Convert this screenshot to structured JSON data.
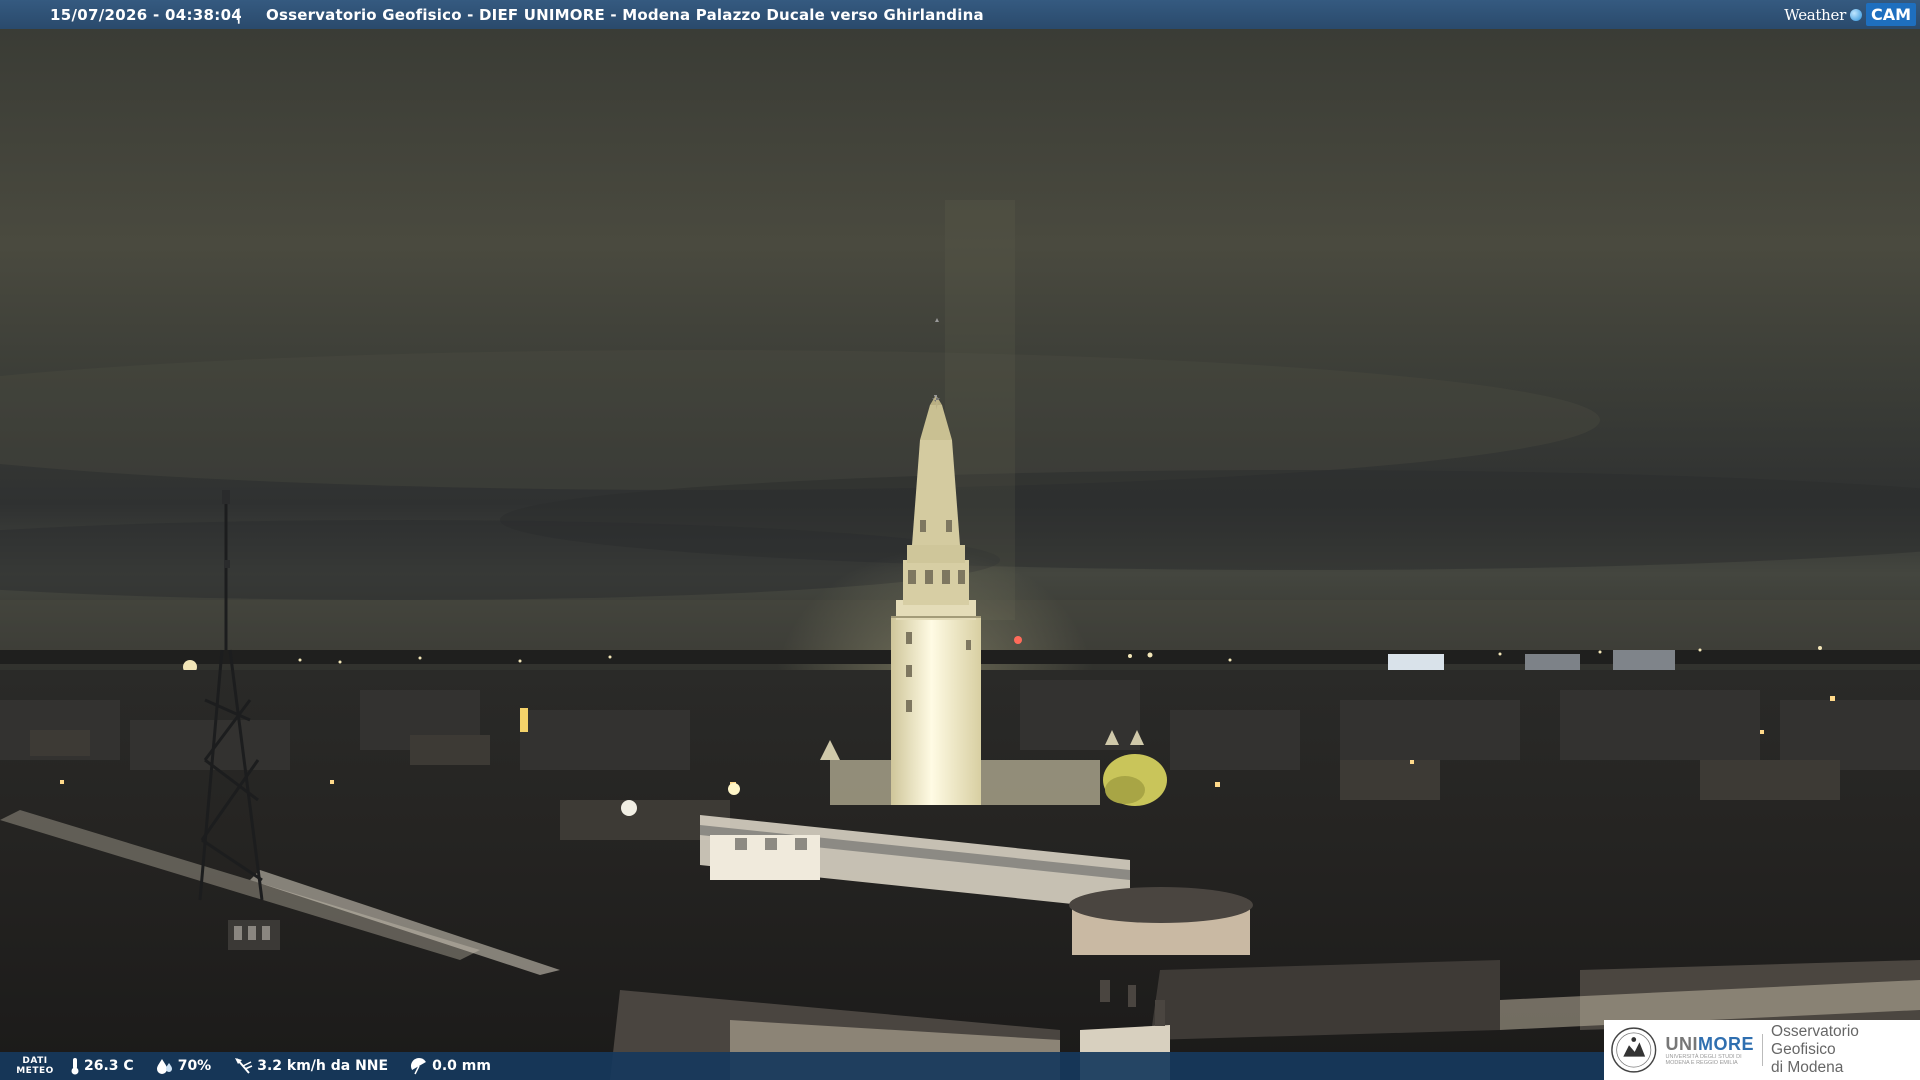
{
  "header": {
    "timestamp": "15/07/2026 - 04:38:04",
    "separator": "|",
    "camera_title": "Osservatorio Geofisico - DIEF UNIMORE - Modena Palazzo Ducale verso Ghirlandina",
    "brand_weather": "Weather",
    "brand_cam": "CAM"
  },
  "weather_bar": {
    "dati_line1": "DATI",
    "dati_line2": "METEO",
    "temperature": "26.3 C",
    "humidity": "70%",
    "wind": "3.2 km/h da NNE",
    "rain": "0.0 mm"
  },
  "logo": {
    "uni_prefix": "UNI",
    "uni_suffix": "MORE",
    "uni_sub_line1": "UNIVERSITÀ DEGLI STUDI DI",
    "uni_sub_line2": "MODENA E REGGIO EMILIA",
    "obs_line1": "Osservatorio Geofisico",
    "obs_line2": "di Modena"
  },
  "colors": {
    "top_bar": "#2a4a6c",
    "bottom_bar": "#16385c",
    "accent_blue": "#2f6fb0",
    "sky": "#3b3b33"
  },
  "icons": {
    "temperature": "thermometer-icon",
    "humidity": "droplet-icon",
    "wind": "wind-vane-icon",
    "rain": "umbrella-icon"
  }
}
